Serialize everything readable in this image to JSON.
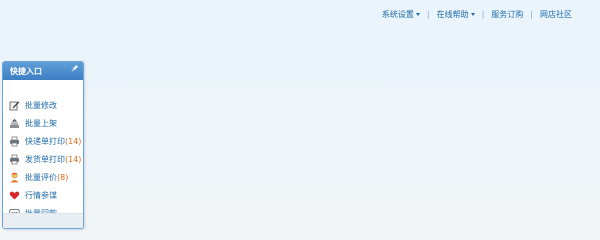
{
  "topnav": {
    "system_settings": "系统设置",
    "online_help": "在线帮助",
    "service_order": "服务订购",
    "community": "网店社区",
    "separator": "|"
  },
  "quick_entry": {
    "title": "快捷入口",
    "items": [
      {
        "label": "批量修改",
        "count": "",
        "icon": "edit-icon"
      },
      {
        "label": "批量上架",
        "count": "",
        "icon": "stack-upload-icon"
      },
      {
        "label": "快递单打印",
        "count": "(14)",
        "icon": "printer-icon"
      },
      {
        "label": "发货单打印",
        "count": "(14)",
        "icon": "printer-icon"
      },
      {
        "label": "批量评价",
        "count": "(8)",
        "icon": "reviewer-icon"
      },
      {
        "label": "行情参谋",
        "count": "",
        "icon": "heart-icon"
      },
      {
        "label": "批量回款",
        "count": "",
        "icon": "chat-icon"
      }
    ]
  },
  "colors": {
    "link": "#1e6aa8",
    "count": "#d96a1a",
    "panel_header": "#4a8acb"
  }
}
